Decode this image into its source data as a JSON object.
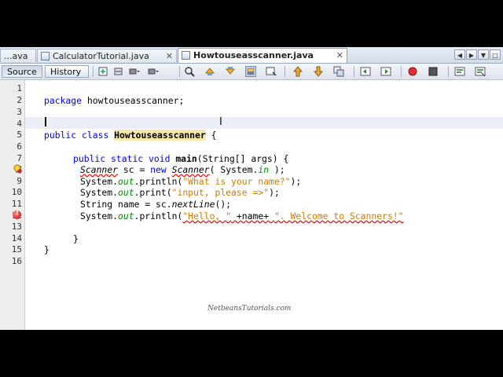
{
  "tabs": [
    {
      "label": "...ava",
      "active": false
    },
    {
      "label": "CalculatorTutorial.java",
      "active": false
    },
    {
      "label": "Howtouseasscanner.java",
      "active": true
    }
  ],
  "tab_close_glyph": "✕",
  "toolbar": {
    "source_label": "Source",
    "history_label": "History"
  },
  "editor": {
    "line_numbers": [
      "1",
      "2",
      "3",
      "4",
      "5",
      "6",
      "7",
      "8",
      "9",
      "10",
      "11",
      "12",
      "13",
      "14",
      "15",
      "16"
    ],
    "lines": {
      "l2_kw": "package",
      "l2_rest": " howtouseasscanner;",
      "l5_kw1": "public",
      "l5_kw2": "class",
      "l5_cls": "Howtouseasscanner",
      "l5_rest": " {",
      "l7_kw1": "public",
      "l7_kw2": "static",
      "l7_kw3": "void",
      "l7_name": "main",
      "l7_rest": "(String[] args) {",
      "l8_t1": "Scanner",
      "l8_t2": " sc = ",
      "l8_kw": "new",
      "l8_t3": "Scanner",
      "l8_t4": "( System.",
      "l8_fld": "in",
      "l8_t5": " );",
      "l9_t1": "System.",
      "l9_fld": "out",
      "l9_t2": ".println(",
      "l9_str": "\"What is your name?\"",
      "l9_t3": ");",
      "l10_t1": "System.",
      "l10_fld": "out",
      "l10_t2": ".print(",
      "l10_str": "\"input, please =>\"",
      "l10_t3": ");",
      "l11_t1": "String name = sc.",
      "l11_it": "nextLine",
      "l11_t2": "();",
      "l12_t1": "System.",
      "l12_fld": "out",
      "l12_t2": ".println(",
      "l12_str1": "\"Hello, \"",
      "l12_t3": " +name+ ",
      "l12_str2": "\". Welcome to Scanners!\"",
      "l14": "}",
      "l16": "}"
    }
  },
  "watermark": "NetbeansTutorials.com"
}
